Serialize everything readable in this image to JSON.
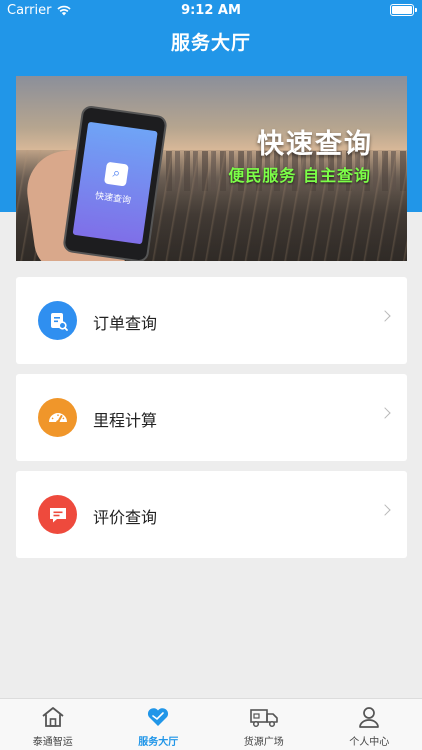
{
  "status_bar": {
    "carrier": "Carrier",
    "time": "9:12 AM"
  },
  "nav": {
    "title": "服务大厅"
  },
  "banner": {
    "title": "快速查询",
    "subtitle": "便民服务  自主查询",
    "phone_app_label": "快速查询"
  },
  "menu": [
    {
      "label": "订单查询",
      "icon": "order-search-icon",
      "color": "#2f8ff0"
    },
    {
      "label": "里程计算",
      "icon": "speedometer-icon",
      "color": "#f0962a"
    },
    {
      "label": "评价查询",
      "icon": "comment-icon",
      "color": "#ee4a3d"
    }
  ],
  "tabbar": {
    "items": [
      {
        "label": "泰通智运",
        "icon": "home-icon"
      },
      {
        "label": "服务大厅",
        "icon": "heart-icon",
        "active": true
      },
      {
        "label": "货源广场",
        "icon": "truck-icon"
      },
      {
        "label": "个人中心",
        "icon": "person-icon"
      }
    ]
  },
  "colors": {
    "primary": "#2196e8",
    "background": "#ededed",
    "banner_subtitle": "#7cff48"
  }
}
